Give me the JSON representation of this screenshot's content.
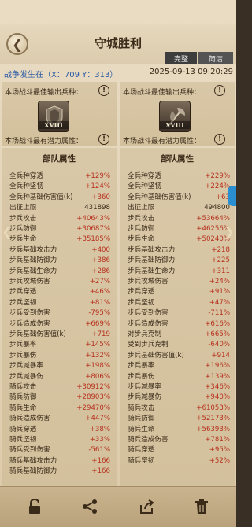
{
  "header": {
    "title": "守城胜利",
    "complete_label": "完整",
    "brief_label": "简洁"
  },
  "info": {
    "war_location": "战争发生在（X：709 Y：313）",
    "datetime": "2025-09-13  09:20:29"
  },
  "left": {
    "best_unit_label": "本场战斗最佳输出兵种：",
    "potential_label": "本场战斗最有潜力属性：",
    "unit_tier": "XVIII",
    "section_title": "部队属性",
    "stats": [
      {
        "name": "全兵种穿透",
        "value": "+129%"
      },
      {
        "name": "全兵种坚韧",
        "value": "+124%"
      },
      {
        "name": "全兵种基础伤害值(k)",
        "value": "+360"
      },
      {
        "name": "出征上限",
        "value": "431898",
        "black": true
      },
      {
        "name": "步兵攻击",
        "value": "+40643%"
      },
      {
        "name": "步兵防御",
        "value": "+30687%"
      },
      {
        "name": "步兵生命",
        "value": "+35185%"
      },
      {
        "name": "步兵基础攻击力",
        "value": "+400"
      },
      {
        "name": "步兵基础防御力",
        "value": "+386"
      },
      {
        "name": "步兵基础生命力",
        "value": "+286"
      },
      {
        "name": "步兵攻城伤害",
        "value": "+27%"
      },
      {
        "name": "步兵穿透",
        "value": "+46%"
      },
      {
        "name": "步兵坚韧",
        "value": "+81%"
      },
      {
        "name": "步兵受到伤害",
        "value": "-795%"
      },
      {
        "name": "步兵造成伤害",
        "value": "+669%"
      },
      {
        "name": "步兵基础伤害值(k)",
        "value": "+719"
      },
      {
        "name": "步兵暴率",
        "value": "+145%"
      },
      {
        "name": "步兵暴伤",
        "value": "+132%"
      },
      {
        "name": "步兵减暴率",
        "value": "+198%"
      },
      {
        "name": "步兵减暴伤",
        "value": "+806%"
      },
      {
        "name": "骑兵攻击",
        "value": "+30912%"
      },
      {
        "name": "骑兵防御",
        "value": "+28903%"
      },
      {
        "name": "骑兵生命",
        "value": "+29470%"
      },
      {
        "name": "骑兵造成伤害",
        "value": "+447%"
      },
      {
        "name": "骑兵穿透",
        "value": "+38%"
      },
      {
        "name": "骑兵坚韧",
        "value": "+33%"
      },
      {
        "name": "骑兵受到伤害",
        "value": "-561%"
      },
      {
        "name": "骑兵基础攻击力",
        "value": "+166"
      },
      {
        "name": "骑兵基础防御力",
        "value": "+166"
      }
    ]
  },
  "right": {
    "best_unit_label": "本场战斗最佳输出兵种：",
    "potential_label": "本场战斗最有潜力属性：",
    "unit_tier": "XVIII",
    "section_title": "部队属性",
    "stats": [
      {
        "name": "全兵种穿透",
        "value": "+229%"
      },
      {
        "name": "全兵种坚韧",
        "value": "+224%"
      },
      {
        "name": "全兵种基础伤害值(k)",
        "value": "+63"
      },
      {
        "name": "出征上限",
        "value": "494800",
        "black": true
      },
      {
        "name": "步兵攻击",
        "value": "+53664%"
      },
      {
        "name": "步兵防御",
        "value": "+46256%"
      },
      {
        "name": "步兵生命",
        "value": "+50240%"
      },
      {
        "name": "步兵基础攻击力",
        "value": "+218"
      },
      {
        "name": "步兵基础防御力",
        "value": "+225"
      },
      {
        "name": "步兵基础生命力",
        "value": "+311"
      },
      {
        "name": "步兵攻城伤害",
        "value": "+24%"
      },
      {
        "name": "步兵穿透",
        "value": "+91%"
      },
      {
        "name": "步兵坚韧",
        "value": "+47%"
      },
      {
        "name": "步兵受到伤害",
        "value": "-711%"
      },
      {
        "name": "步兵造成伤害",
        "value": "+616%"
      },
      {
        "name": "对步兵克制",
        "value": "+665%"
      },
      {
        "name": "受到步兵克制",
        "value": "-640%"
      },
      {
        "name": "步兵基础伤害值(k)",
        "value": "+914"
      },
      {
        "name": "步兵暴率",
        "value": "+196%"
      },
      {
        "name": "步兵暴伤",
        "value": "+139%"
      },
      {
        "name": "步兵减暴率",
        "value": "+346%"
      },
      {
        "name": "步兵减暴伤",
        "value": "+940%"
      },
      {
        "name": "骑兵攻击",
        "value": "+61053%"
      },
      {
        "name": "骑兵防御",
        "value": "+52173%"
      },
      {
        "name": "骑兵生命",
        "value": "+56393%"
      },
      {
        "name": "骑兵造成伤害",
        "value": "+781%"
      },
      {
        "name": "骑兵穿透",
        "value": "+95%"
      },
      {
        "name": "骑兵坚韧",
        "value": "+52%"
      }
    ]
  },
  "toolbar": {
    "icons": [
      "lock-icon",
      "share-icon",
      "export-icon",
      "trash-icon"
    ]
  },
  "colors": {
    "value_red": "#b7311e",
    "label_blue": "#2b5aa5",
    "background": "#e3d4b8"
  }
}
